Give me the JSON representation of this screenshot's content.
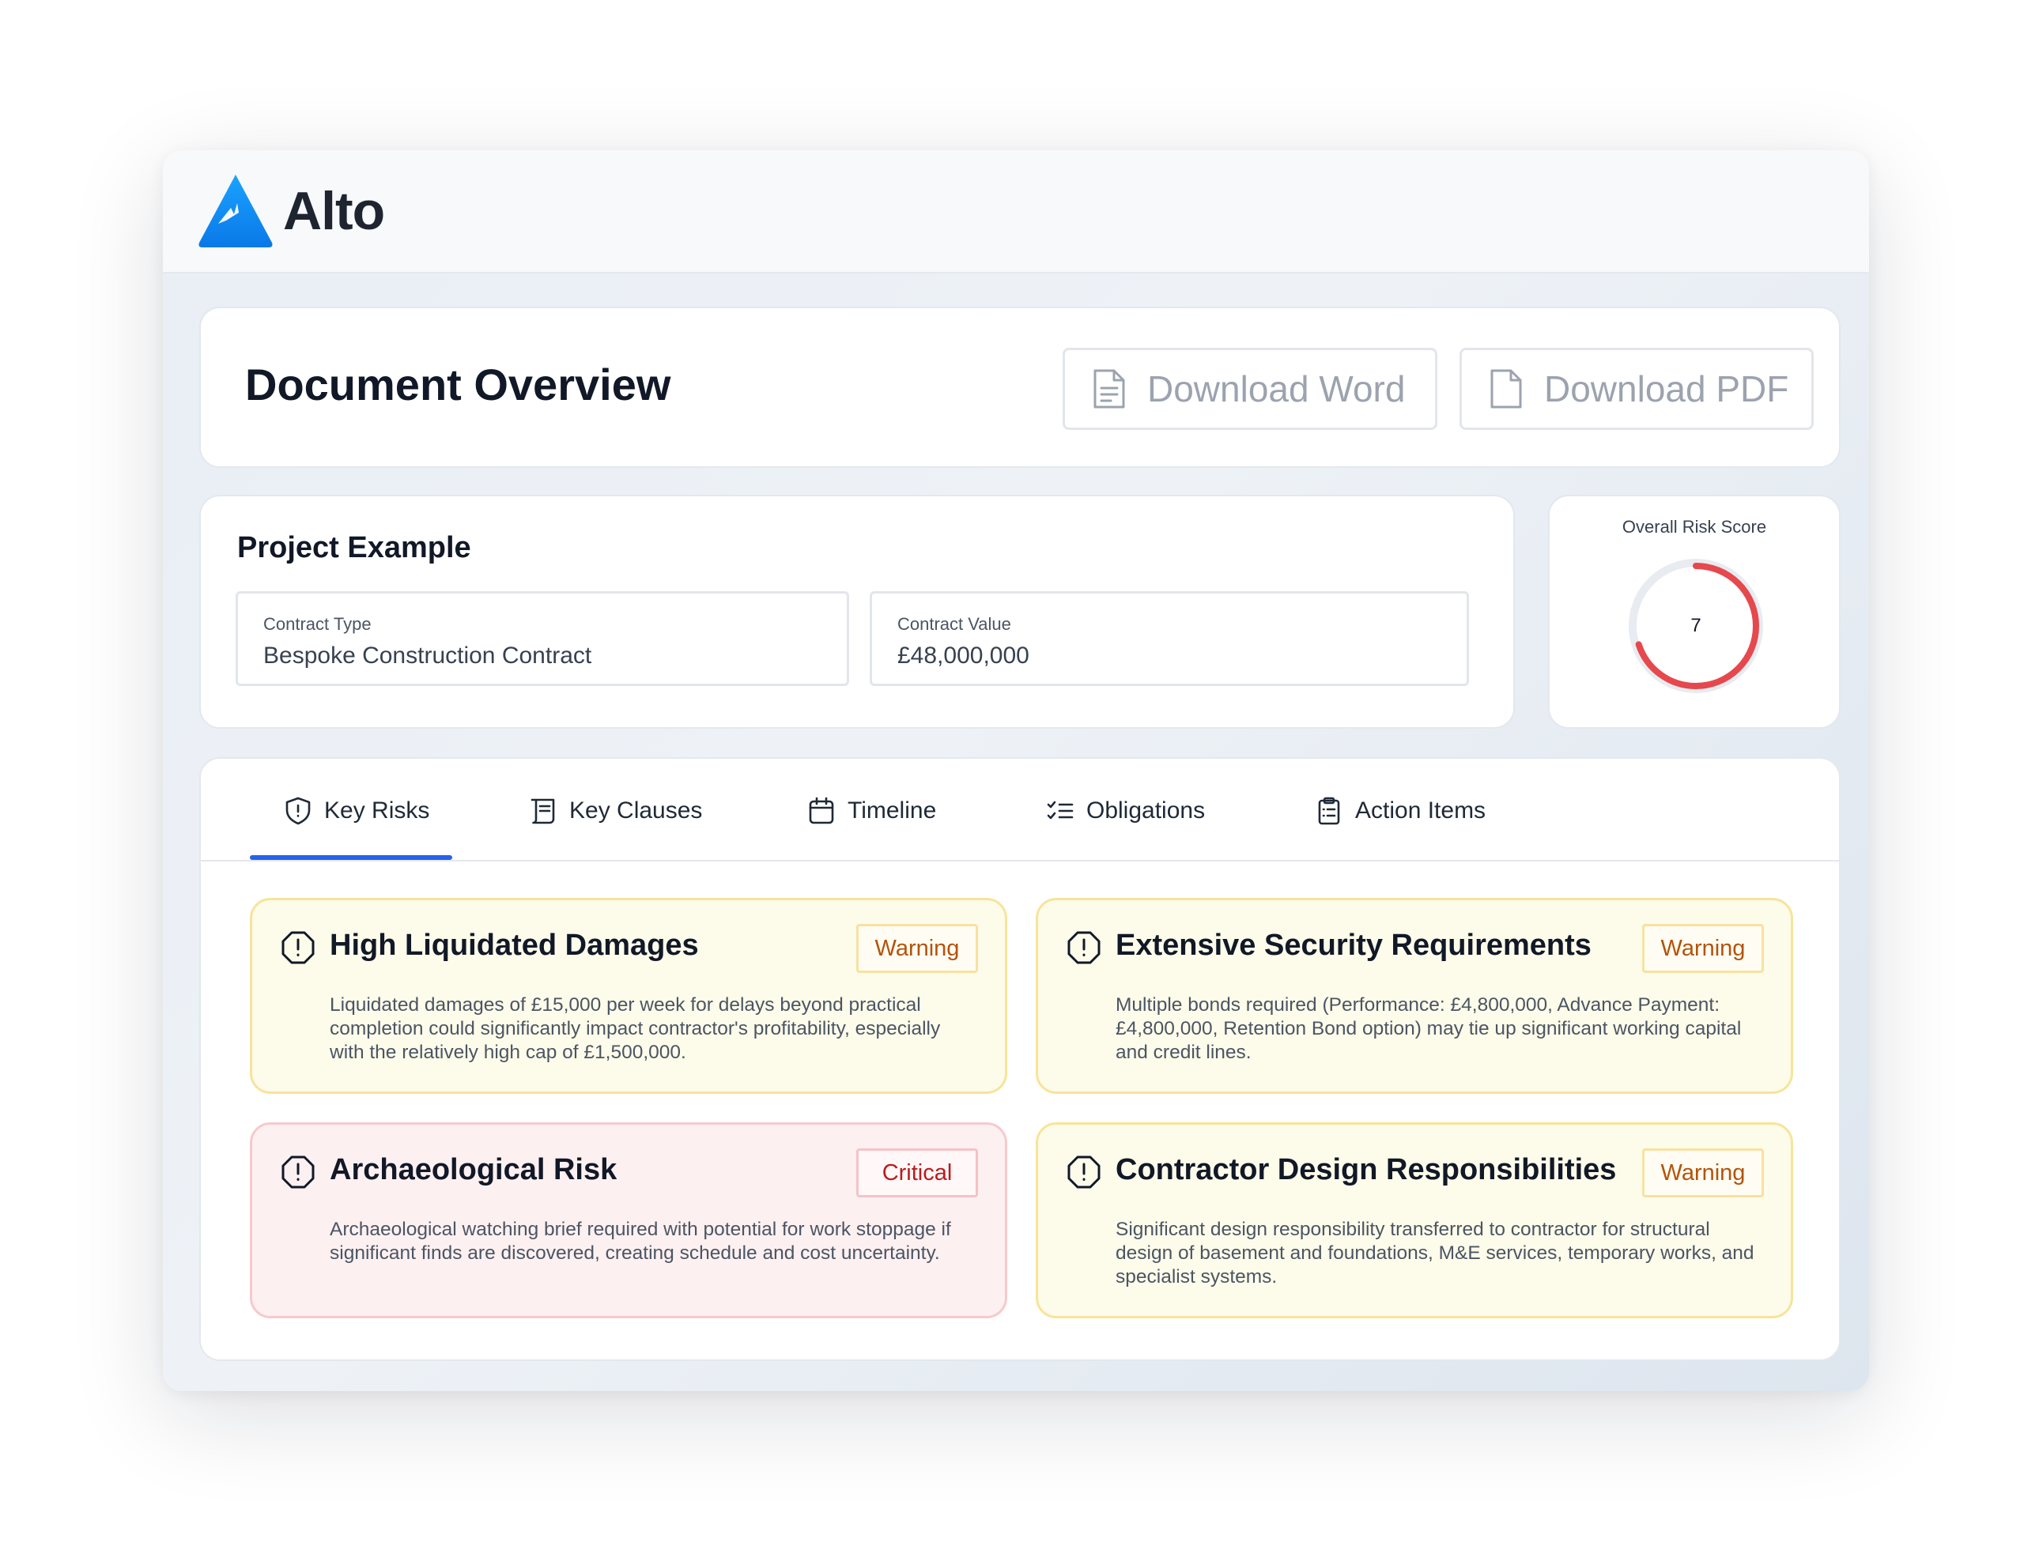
{
  "app": {
    "name": "Alto"
  },
  "overview": {
    "title": "Document Overview",
    "download_word_label": "Download Word",
    "download_pdf_label": "Download PDF"
  },
  "project": {
    "title": "Project Example",
    "contract_type_label": "Contract Type",
    "contract_type_value": "Bespoke Construction Contract",
    "contract_value_label": "Contract Value",
    "contract_value_value": "£48,000,000"
  },
  "risk_score": {
    "label": "Overall Risk Score",
    "value": "7",
    "fraction": 0.7,
    "color": "#e5484d"
  },
  "tabs": [
    {
      "label": "Key Risks",
      "icon": "shield-alert-icon",
      "active": true
    },
    {
      "label": "Key Clauses",
      "icon": "scroll-icon",
      "active": false
    },
    {
      "label": "Timeline",
      "icon": "calendar-icon",
      "active": false
    },
    {
      "label": "Obligations",
      "icon": "list-checks-icon",
      "active": false
    },
    {
      "label": "Action Items",
      "icon": "clipboard-list-icon",
      "active": false
    }
  ],
  "risks": [
    {
      "title": "High Liquidated Damages",
      "badge": "Warning",
      "severity": "warning",
      "description": "Liquidated damages of £15,000 per week for delays beyond practical completion could significantly impact contractor's profitability, especially with the relatively high cap of £1,500,000."
    },
    {
      "title": "Extensive Security Requirements",
      "badge": "Warning",
      "severity": "warning",
      "description": "Multiple bonds required (Performance: £4,800,000, Advance Payment: £4,800,000, Retention Bond option) may tie up significant working capital and credit lines."
    },
    {
      "title": "Archaeological Risk",
      "badge": "Critical",
      "severity": "critical",
      "description": "Archaeological watching brief required with potential for work stoppage if significant finds are discovered, creating schedule and cost uncertainty."
    },
    {
      "title": "Contractor Design Responsibilities",
      "badge": "Warning",
      "severity": "warning",
      "description": "Significant design responsibility transferred to contractor for structural design of basement and foundations, M&E services, temporary works, and specialist systems."
    }
  ],
  "colors": {
    "accent": "#2563eb",
    "logo": "#0a8cf0",
    "warning_bg": "#fdfbea",
    "critical_bg": "#fdf0f1"
  }
}
